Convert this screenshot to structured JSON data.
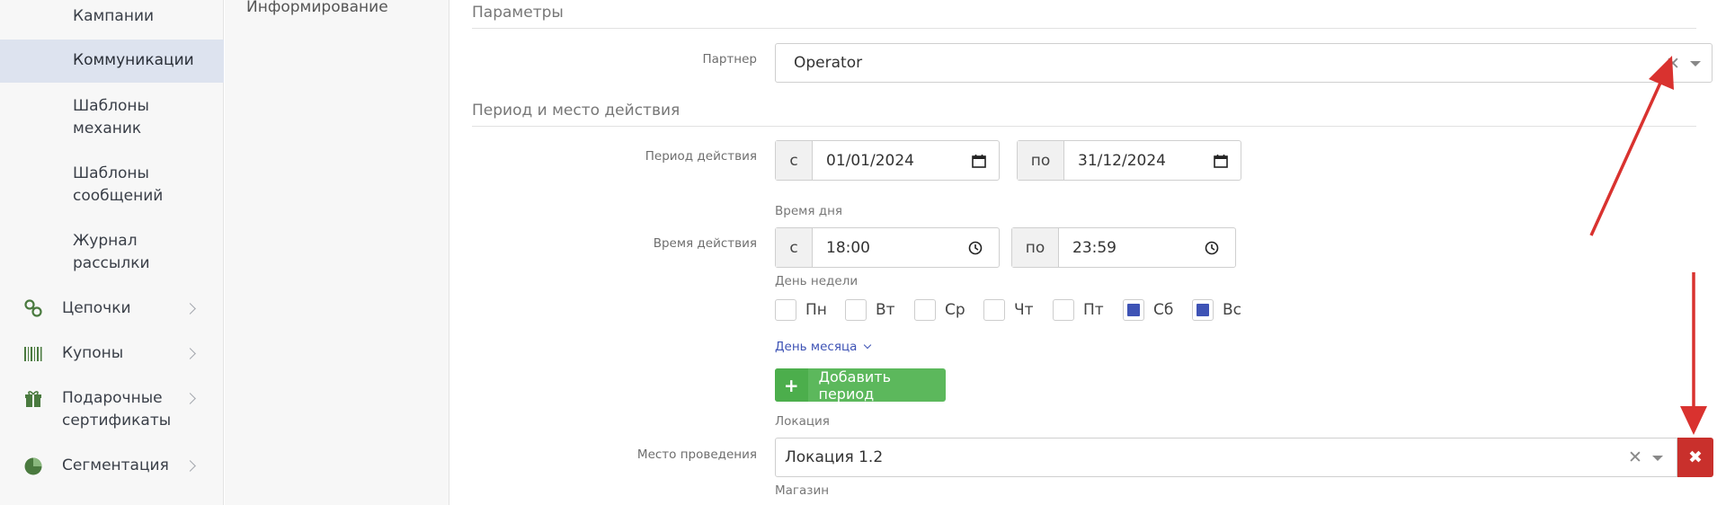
{
  "sidebar": {
    "campaigns": "Кампании",
    "communications": "Коммуникации",
    "mechanic_templates": "Шаблоны механик",
    "message_templates": "Шаблоны сообщений",
    "mailing_log": "Журнал рассылки",
    "chains": "Цепочки",
    "coupons": "Купоны",
    "gift_certificates": "Подарочные сертификаты",
    "segmentation": "Сегментация"
  },
  "secondary_nav": {
    "informing": "Информирование"
  },
  "form": {
    "params_title": "Параметры",
    "partner_label": "Партнер",
    "partner_value": "Operator",
    "period_section_title": "Период и место действия",
    "period_label": "Период действия",
    "from": "с",
    "to": "по",
    "date_from": "01/01/2024",
    "date_to": "31/12/2024",
    "time_of_day_label": "Время дня",
    "time_label": "Время действия",
    "time_from": "18:00",
    "time_to": "23:59",
    "weekday_label": "День недели",
    "weekdays": [
      {
        "label": "Пн",
        "checked": false
      },
      {
        "label": "Вт",
        "checked": false
      },
      {
        "label": "Ср",
        "checked": false
      },
      {
        "label": "Чт",
        "checked": false
      },
      {
        "label": "Пт",
        "checked": false
      },
      {
        "label": "Сб",
        "checked": true
      },
      {
        "label": "Вс",
        "checked": true
      }
    ],
    "month_day_link": "День месяца",
    "add_period": "Добавить период",
    "location_label": "Локация",
    "place_label": "Место проведения",
    "location_value": "Локация 1.2",
    "store_label": "Магазин"
  },
  "colors": {
    "accent": "#3e53b5",
    "success": "#5cb85c",
    "danger": "#c9302c",
    "arrow": "#d9322f"
  }
}
